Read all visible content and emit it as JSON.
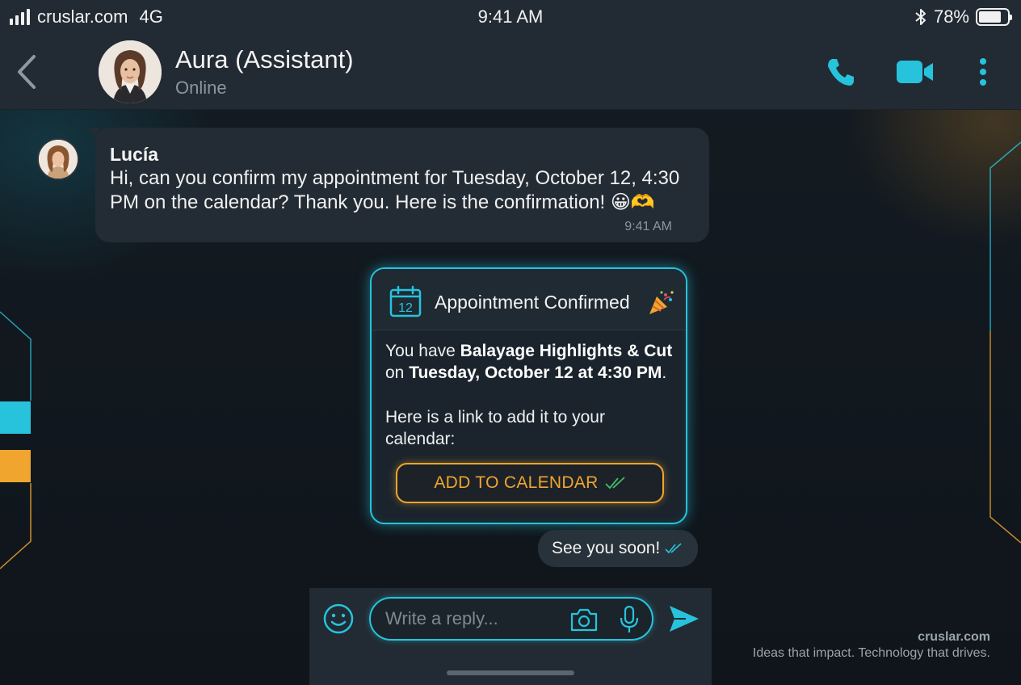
{
  "status_bar": {
    "carrier": "cruslar.com",
    "network": "4G",
    "time": "9:41 AM",
    "battery_text": "78%",
    "battery_level": 0.78
  },
  "header": {
    "contact_name": "Aura (Assistant)",
    "contact_status": "Online"
  },
  "incoming_message": {
    "sender": "Lucía",
    "text": "Hi, can you confirm my appointment for Tuesday, October 12, 4:30 PM on the calendar? Thank you. Here is the confirmation! 😀🫶",
    "time": "9:41 AM"
  },
  "appointment_card": {
    "calendar_day": "12",
    "title": "Appointment Confirmed",
    "body_prefix": "You have ",
    "service": "Balayage Highlights & Cut",
    "body_middle": " on ",
    "datetime": "Tuesday, October 12 at 4:30 PM",
    "body_suffix": ".",
    "link_text": "Here is a link to add it to your calendar:",
    "button_label": "ADD TO CALENDAR"
  },
  "outgoing_message": {
    "text": "See you soon!"
  },
  "composer": {
    "placeholder": "Write a reply..."
  },
  "branding": {
    "domain": "cruslar.com",
    "tagline": "Ideas that impact. Technology that drives."
  },
  "colors": {
    "accent_cyan": "#27c3dd",
    "accent_orange": "#f0a52e",
    "check_green": "#3fbf6a",
    "background": "#141b22"
  },
  "icons": [
    "back-icon",
    "phone-icon",
    "video-call-icon",
    "more-icon",
    "calendar-icon",
    "party-popper-icon",
    "double-check-icon",
    "emoji-icon",
    "camera-icon",
    "mic-icon",
    "send-icon",
    "bluetooth-icon",
    "signal-icon",
    "battery-icon"
  ]
}
